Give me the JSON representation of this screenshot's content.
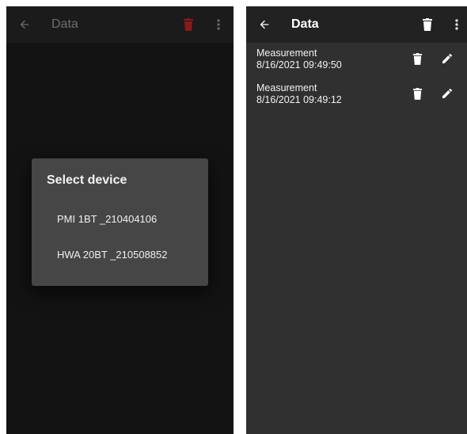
{
  "left_screen": {
    "appbar": {
      "back_icon": "arrow-left-icon",
      "title": "Data",
      "delete_icon": "trash-icon",
      "menu_icon": "more-vert-icon"
    },
    "dialog": {
      "title": "Select device",
      "options": [
        "PMI 1BT _210404106",
        "HWA 20BT _210508852"
      ]
    }
  },
  "right_screen": {
    "appbar": {
      "back_icon": "arrow-left-icon",
      "title": "Data",
      "delete_icon": "trash-icon",
      "menu_icon": "more-vert-icon"
    },
    "items": [
      {
        "name": "Measurement",
        "timestamp": "8/16/2021 09:49:50",
        "delete_icon": "trash-icon",
        "edit_icon": "pencil-icon"
      },
      {
        "name": "Measurement",
        "timestamp": "8/16/2021 09:49:12",
        "delete_icon": "trash-icon",
        "edit_icon": "pencil-icon"
      }
    ]
  },
  "colors": {
    "left_background": "#131313",
    "left_appbar": "#1b1b1b",
    "dimmed_title": "#6d6d6d",
    "dimmed_delete": "#8b1a1a",
    "dialog_background": "#464646",
    "right_background": "#303030",
    "right_appbar": "#222222",
    "text": "#ffffff"
  }
}
